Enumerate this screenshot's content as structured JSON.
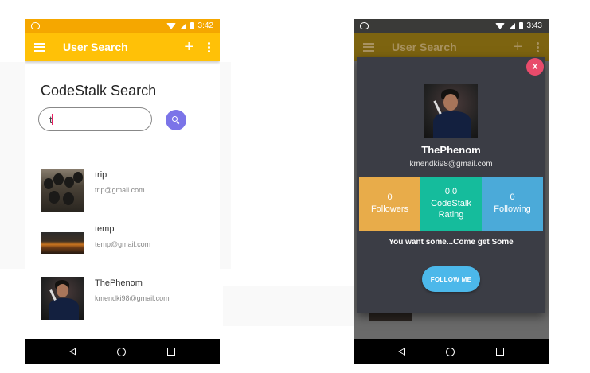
{
  "colors": {
    "accent": "#ffc107",
    "status_bar": "#f5a700",
    "search_button": "#7b74e8",
    "close_button": "#e84b6b",
    "followers_tile": "#e8ac4a",
    "rating_tile": "#15bc9c",
    "following_tile": "#4baad9",
    "follow_button": "#4cb8ea",
    "dialog_background": "#3b3d45"
  },
  "left_phone": {
    "status_bar": {
      "time": "3:42"
    },
    "app_bar": {
      "title": "User Search",
      "menu_icon": "hamburger-icon",
      "add_icon": "plus-icon",
      "more_icon": "overflow-icon"
    },
    "search": {
      "heading": "CodeStalk Search",
      "input_value": "t",
      "button_icon": "search-icon"
    },
    "users": [
      {
        "name": "trip",
        "email": "trip@gmail.com"
      },
      {
        "name": "temp",
        "email": "temp@gmail.com"
      },
      {
        "name": "ThePhenom",
        "email": "kmendki98@gmail.com"
      }
    ]
  },
  "right_phone": {
    "status_bar": {
      "time": "3:43"
    },
    "app_bar": {
      "title": "User Search"
    },
    "profile_dialog": {
      "close_label": "X",
      "name": "ThePhenom",
      "email": "kmendki98@gmail.com",
      "followers": {
        "value": "0",
        "label": "Followers"
      },
      "rating": {
        "value": "0.0",
        "label": "CodeStalk Rating"
      },
      "following": {
        "value": "0",
        "label": "Following"
      },
      "tagline": "You want some...Come get Some",
      "follow_label": "FOLLOW ME"
    }
  }
}
